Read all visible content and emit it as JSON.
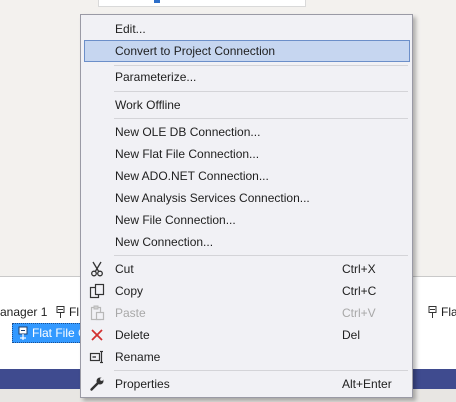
{
  "menu": {
    "edit": "Edit...",
    "convert": "Convert to Project Connection",
    "parameterize": "Parameterize...",
    "work_offline": "Work Offline",
    "new_oledb": "New OLE DB Connection...",
    "new_flat_file": "New Flat File Connection...",
    "new_adonet": "New ADO.NET Connection...",
    "new_analysis": "New Analysis Services Connection...",
    "new_file": "New File Connection...",
    "new_connection": "New Connection...",
    "cut": "Cut",
    "cut_shortcut": "Ctrl+X",
    "copy": "Copy",
    "copy_shortcut": "Ctrl+C",
    "paste": "Paste",
    "paste_shortcut": "Ctrl+V",
    "delete": "Delete",
    "delete_shortcut": "Del",
    "rename": "Rename",
    "properties": "Properties",
    "properties_shortcut": "Alt+Enter",
    "icons": {
      "cut": "scissors-icon",
      "copy": "copy-icon",
      "paste": "paste-icon",
      "delete": "delete-x-icon",
      "rename": "rename-icon",
      "properties": "wrench-icon"
    }
  },
  "tray": {
    "tab1": "anager 1",
    "tab2": "Fl",
    "tab3": "Fla",
    "selected_item": "Flat File C"
  },
  "colors": {
    "hover_bg": "#c6d6f0",
    "hover_border": "#6c8fc9",
    "selection": "#3399ff",
    "status_bar": "#3f4b8f",
    "delete_red": "#d22f2f"
  }
}
